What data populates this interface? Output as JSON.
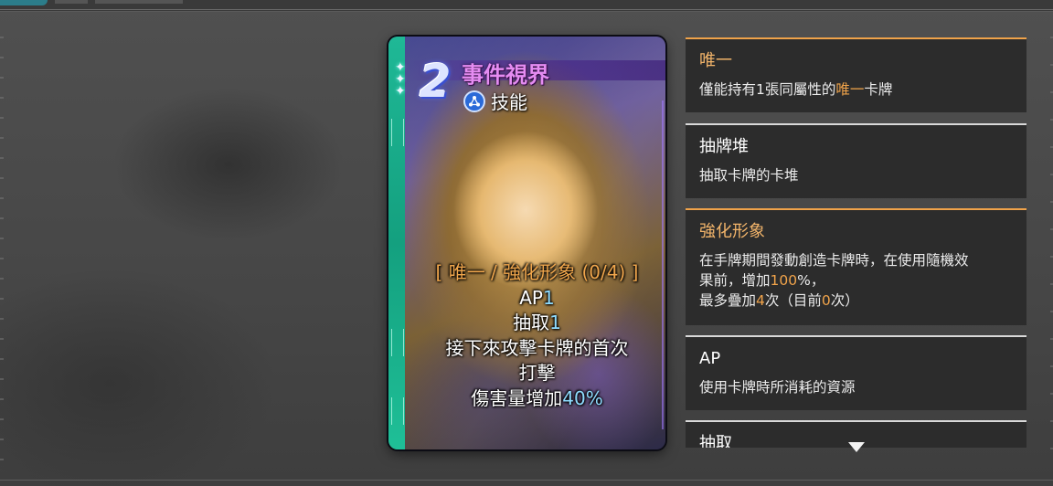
{
  "card": {
    "cost": "2",
    "title": "事件視界",
    "type_label": "技能",
    "type_icon": "skill-triangle-icon",
    "stripe_color": "#1fb896",
    "title_color": "#e58cf2",
    "text": {
      "tags": "[ 唯一 / 強化形象 (0/4) ]",
      "ap_label": "AP",
      "ap_value": "1",
      "draw_label": "抽取",
      "draw_value": "1",
      "line3": "接下來攻擊卡牌的首次",
      "line4": "打擊",
      "damage_label": "傷害量增加",
      "damage_value": "40%"
    }
  },
  "tooltips": [
    {
      "title": "唯一",
      "desc_a": "僅能持有1張同屬性的",
      "desc_hl": "唯一",
      "desc_b": "卡牌"
    },
    {
      "title": "抽牌堆",
      "desc": "抽取卡牌的卡堆"
    },
    {
      "title": "強化形象",
      "line1": "在手牌期間發動創造卡牌時，在使用隨機效",
      "line2_a": "果前，增加",
      "line2_hl": "100",
      "line2_b": "%，",
      "line3_a": "最多疊加",
      "line3_hl1": "4",
      "line3_b": "次（目前",
      "line3_hl2": "0",
      "line3_c": "次）"
    },
    {
      "title": "AP",
      "desc": "使用卡牌時所消耗的資源"
    },
    {
      "title": "抽取"
    }
  ],
  "scroll_icon": "chevron-down-icon",
  "accent_color": "#f0a34a"
}
